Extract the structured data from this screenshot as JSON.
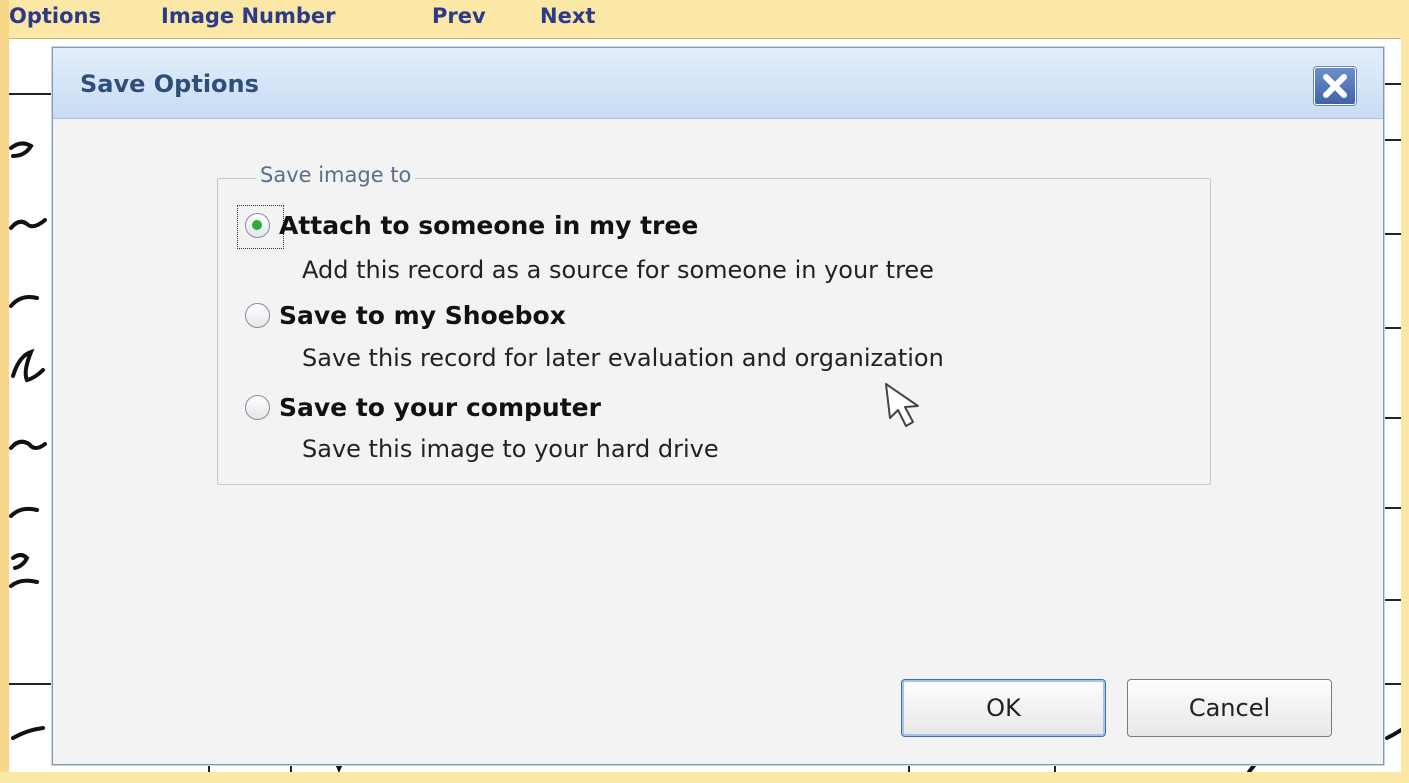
{
  "toolbar": {
    "items": [
      "Options",
      "Image Number",
      "Prev",
      "Next"
    ]
  },
  "dialog": {
    "title": "Save Options",
    "close_icon": "close-icon",
    "group_label": "Save image to",
    "options": [
      {
        "label": "Attach to someone in my tree",
        "description": "Add this record as a source for someone in your tree",
        "checked": true
      },
      {
        "label": "Save to my Shoebox",
        "description": "Save this record for later evaluation and organization",
        "checked": false
      },
      {
        "label": "Save to your computer",
        "description": "Save this image to your hard drive",
        "checked": false
      }
    ],
    "ok_label": "OK",
    "cancel_label": "Cancel"
  },
  "colors": {
    "frame": "#fbe7a6",
    "title_text": "#2d4f7a",
    "radio_selected": "#27b13a",
    "toolbar_link": "#2c3a8a"
  }
}
